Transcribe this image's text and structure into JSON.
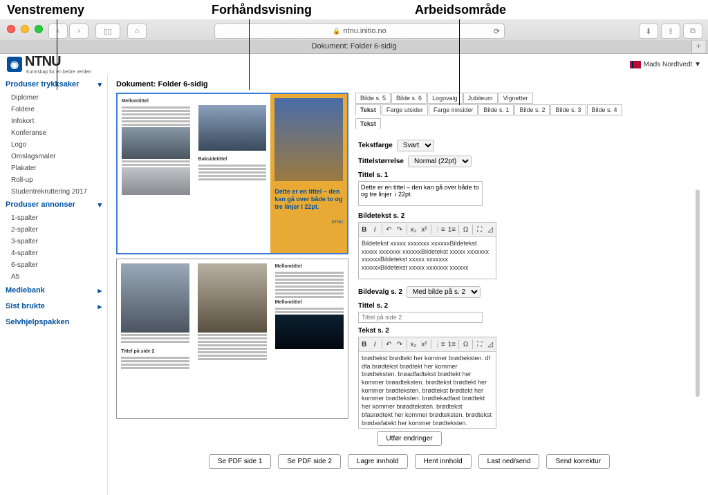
{
  "annotations": {
    "left": "Venstremeny",
    "middle": "Forhåndsvisning",
    "right": "Arbeidsområde"
  },
  "browser": {
    "url": "ntnu.initio.no",
    "tab_title": "Dokument: Folder 6-sidig"
  },
  "user": "Mads Nordtvedt ▼",
  "logo_text": "NTNU",
  "logo_sub": "Kunnskap for en bedre verden",
  "sidebar": {
    "section1": "Produser trykksaker",
    "items1": [
      "Diplomer",
      "Foldere",
      "Infokort",
      "Konferanse",
      "Logo",
      "Omslagsmaler",
      "Plakater",
      "Roll-up",
      "Studentrekruttering 2017"
    ],
    "section2": "Produser annonser",
    "items2": [
      "1-spalter",
      "2-spalter",
      "3-spalter",
      "4-spalter",
      "6-spalter",
      "A5"
    ],
    "plain": [
      "Mediebank",
      "Sist brukte",
      "Selvhjelpspakken"
    ]
  },
  "doc_title": "Dokument: Folder 6-sidig",
  "preview_title": "Dette er en tittel – den kan gå over både to og tre linjer i 22pt.",
  "tabs_row1": [
    "Bilde s. 5",
    "Bilde s. 6",
    "Logovalg",
    "Jubileum",
    "Vignetter"
  ],
  "tabs_row2": [
    "Tekst",
    "Farge utsider",
    "Farge innsider",
    "Bilde s. 1",
    "Bilde s. 2",
    "Bilde s. 3",
    "Bilde s. 4"
  ],
  "subtab": "Tekst",
  "form": {
    "tekstfarge_label": "Tekstfarge",
    "tekstfarge_value": "Svart",
    "tittelstorrelse_label": "Tittelstørrelse",
    "tittelstorrelse_value": "Normal (22pt)",
    "tittel_s1_label": "Tittel s. 1",
    "tittel_s1_value": "Dette er en tittel – den kan gå over både to og tre linjer  i 22pt.",
    "bildetekst_s2_label": "Bildetekst s. 2",
    "bildetekst_s2_value": "Bildetekst xxxxx xxxxxxx xxxxxxBildetekst xxxxx xxxxxxx xxxxxxBildetekst xxxxx xxxxxxx xxxxxxBildetekst xxxxx xxxxxxx xxxxxxBildetekst xxxxx xxxxxxx xxxxxx",
    "bildevalg_s2_label": "Bildevalg s. 2",
    "bildevalg_s2_value": "Med bilde på s. 2",
    "tittel_s2_label": "Tittel s. 2",
    "tittel_s2_placeholder": "Tittel på side 2",
    "tekst_s2_label": "Tekst s. 2",
    "tekst_s2_value": "brødtekst brødtekt her kommer brødteksten. df dfa brødtekst brødtekt her kommer brødteksten. brøadfadtekst brødtekt her kommer brøadteksten. brødtekst brødtekt her kommer brødteksten. brødtekst brødtekt her kommer brødteksten. brødtekadfast brødtekt her kommer brøadteksten. brødtekst bfasrødtekt her kommer brødteksten. brødtekst brødasfatekt her kommer brødteksten. brødtekst brødtektaf her kommer brødteksten. brødtekst brødtekt hdafaer kommer brødteksten. brødtekst brødtekt her"
  },
  "buttons": {
    "utfor": "Utfør endringer",
    "pdf1": "Se PDF side 1",
    "pdf2": "Se PDF side 2",
    "lagre": "Lagre innhold",
    "hent": "Hent innhold",
    "last": "Last ned/send",
    "send": "Send korrektur"
  }
}
